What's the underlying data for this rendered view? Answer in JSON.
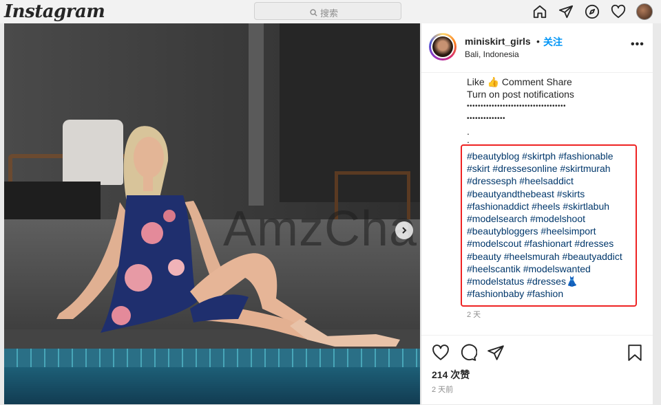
{
  "topbar": {
    "logo": "Instagram",
    "search_placeholder": "搜索"
  },
  "photo": {
    "watermark": "AmzChart"
  },
  "post": {
    "username": "miniskirt_girls",
    "separator": "•",
    "follow_label": "关注",
    "location": "Bali, Indonesia",
    "more_label": "•••",
    "caption_lines": [
      "Like 👍 Comment Share",
      "Turn on post notifications",
      "••••••••••••••••••••••••••••••••••••",
      "••••••••••••••",
      ".",
      "."
    ],
    "hashtag_lines": [
      "#beautyblog #skirtph #fashionable",
      "#skirt #dressesonline #skirtmurah",
      "#dressesph #heelsaddict",
      "#beautyandthebeast #skirts",
      "#fashionaddict #heels #skirtlabuh",
      "#modelsearch #modelshoot",
      "#beautybloggers #heelsimport",
      "#modelscout #fashionart #dresses",
      "#beauty #heelsmurah #beautyaddict",
      "#heelscantik #modelswanted",
      "#modelstatus #dresses👗",
      "#fashionbaby #fashion"
    ],
    "caption_time": "2 天",
    "likes": "214 次赞",
    "post_time": "2 天前"
  },
  "colors": {
    "link_blue": "#00376b",
    "follow_blue": "#0095f6",
    "highlight_red": "#e22"
  },
  "icons": [
    "home-icon",
    "direct-icon",
    "explore-icon",
    "heart-icon",
    "comment-icon",
    "share-icon",
    "bookmark-icon",
    "search-icon",
    "chevron-right-icon"
  ]
}
